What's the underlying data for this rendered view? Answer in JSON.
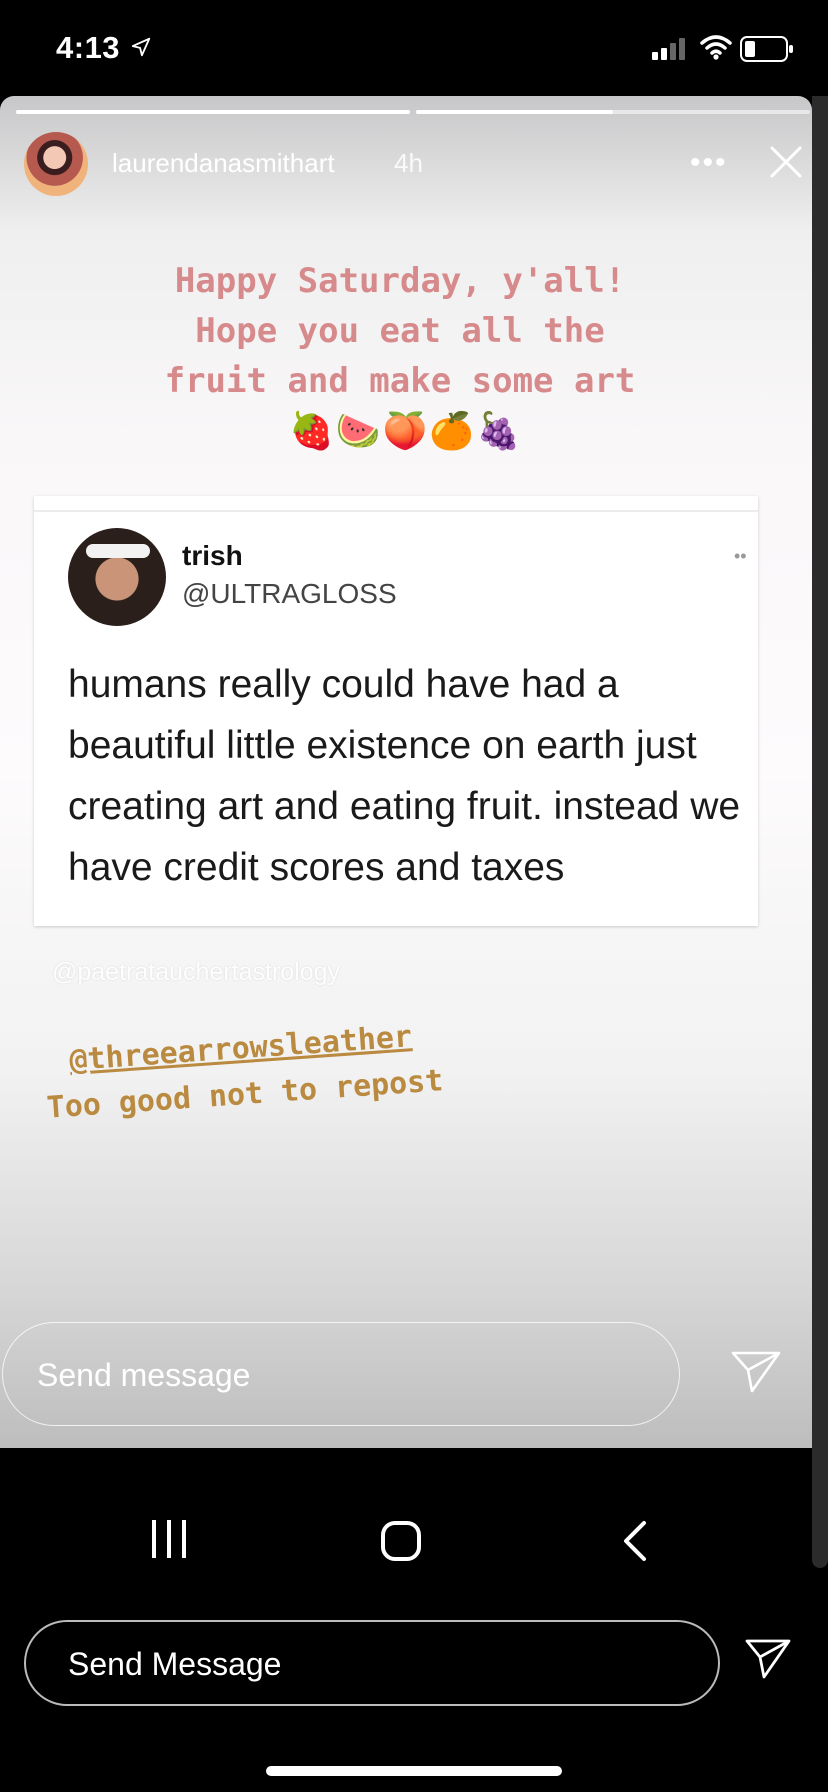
{
  "status_bar": {
    "time": "4:13",
    "location_icon": "location-arrow-icon",
    "signal_icon": "cellular-signal-icon",
    "wifi_icon": "wifi-icon",
    "battery_icon": "battery-icon"
  },
  "story": {
    "progress": [
      {
        "fill": 1.0
      },
      {
        "fill": 0.5
      },
      {
        "fill": 0.0
      }
    ],
    "header": {
      "username": "laurendanasmithart",
      "age": "4h",
      "more_icon": "more-options-icon",
      "close_icon": "close-icon"
    },
    "caption_lines": [
      "Happy Saturday, y'all!",
      "Hope you eat all the",
      "fruit and make some art"
    ],
    "fruit_emojis": "🍓🍉🍑🍊🍇",
    "tweet": {
      "name": "trish",
      "handle": "@ULTRAGLOSS",
      "text": "humans really could have had a beautiful little existence on earth just creating art and eating fruit. instead we have credit scores and taxes"
    },
    "watermark": "@paetratauchertastrology",
    "mention": "@threearrowsleather",
    "comment": "Too good not to repost",
    "reply_placeholder": "Send message"
  },
  "android_nav": {
    "recent_icon": "recent-apps-icon",
    "home_icon": "home-icon",
    "back_icon": "back-chevron-icon"
  },
  "footer": {
    "reply_placeholder": "Send Message",
    "send_icon": "paper-plane-icon"
  },
  "colors": {
    "caption_pink": "#d78a8c",
    "mustard": "#b98a3f"
  }
}
